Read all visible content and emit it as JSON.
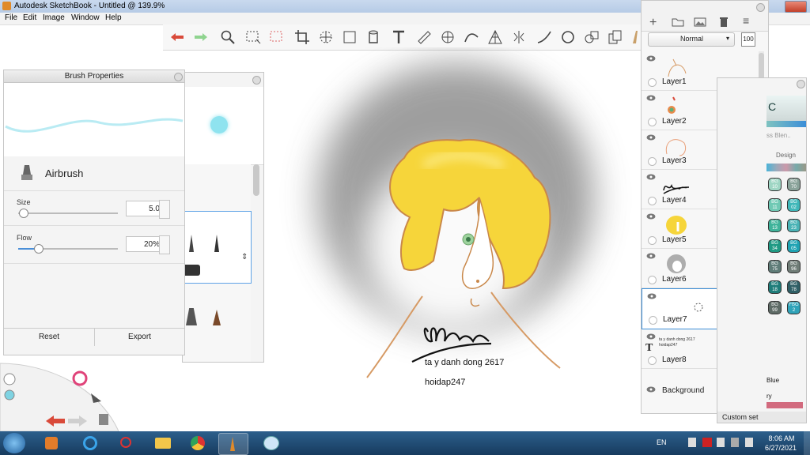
{
  "window": {
    "title": "Autodesk SketchBook - Untitled @ 139.9%"
  },
  "menu": {
    "items": [
      "File",
      "Edit",
      "Image",
      "Window",
      "Help"
    ]
  },
  "brush_properties": {
    "title": "Brush Properties",
    "brush_name": "Airbrush",
    "size_label": "Size",
    "size_value": "5.0",
    "size_fraction": 0.05,
    "flow_label": "Flow",
    "flow_value": "20%",
    "flow_fraction": 0.2,
    "reset_label": "Reset",
    "export_label": "Export"
  },
  "layers_panel": {
    "blend_mode": "Normal",
    "opacity": "100",
    "layers": [
      {
        "name": "Layer1"
      },
      {
        "name": "Layer2"
      },
      {
        "name": "Layer3"
      },
      {
        "name": "Layer4"
      },
      {
        "name": "Layer5"
      },
      {
        "name": "Layer6"
      },
      {
        "name": "Layer7",
        "selected": true
      },
      {
        "name": "Layer8",
        "text_preview": "ta y danh dong 2617 hoidap247"
      },
      {
        "name": "Background"
      }
    ]
  },
  "color_panel": {
    "tab_copic": "C",
    "blend_hint": "ss Blen..",
    "design_label": "Design",
    "blue_label": "Blue",
    "ry_label": "ry",
    "custom_set": "Custom set",
    "swatches": [
      {
        "code": "BG 10",
        "color": "#9fd6c4"
      },
      {
        "code": "BG 70",
        "color": "#8aa39a"
      },
      {
        "code": "BG 11",
        "color": "#6fc9b4"
      },
      {
        "code": "BG 02",
        "color": "#3fb7b9"
      },
      {
        "code": "BG 13",
        "color": "#3fb39a"
      },
      {
        "code": "BG 23",
        "color": "#4ab3b6"
      },
      {
        "code": "BG 34",
        "color": "#1f9a84"
      },
      {
        "code": "BG 05",
        "color": "#1fa3b3"
      },
      {
        "code": "BG 75",
        "color": "#5f7c78"
      },
      {
        "code": "BG 96",
        "color": "#6f7c76"
      },
      {
        "code": "BG 18",
        "color": "#1f7d7a"
      },
      {
        "code": "BG 78",
        "color": "#2f5f66"
      },
      {
        "code": "BG 99",
        "color": "#5e6b66"
      },
      {
        "code": "FBG 2",
        "color": "#2fa3b9"
      }
    ]
  },
  "canvas": {
    "signature_text": "ta y danh dong 2617",
    "site_text": "hoidap247"
  },
  "taskbar": {
    "lang": "EN",
    "time": "8:06 AM",
    "date": "6/27/2021"
  },
  "colors": {
    "accent": "#3b8ed8",
    "hair": "#f6d53a",
    "shadow": "#9a9a9a",
    "selected_layer": "#3b8ed8"
  }
}
